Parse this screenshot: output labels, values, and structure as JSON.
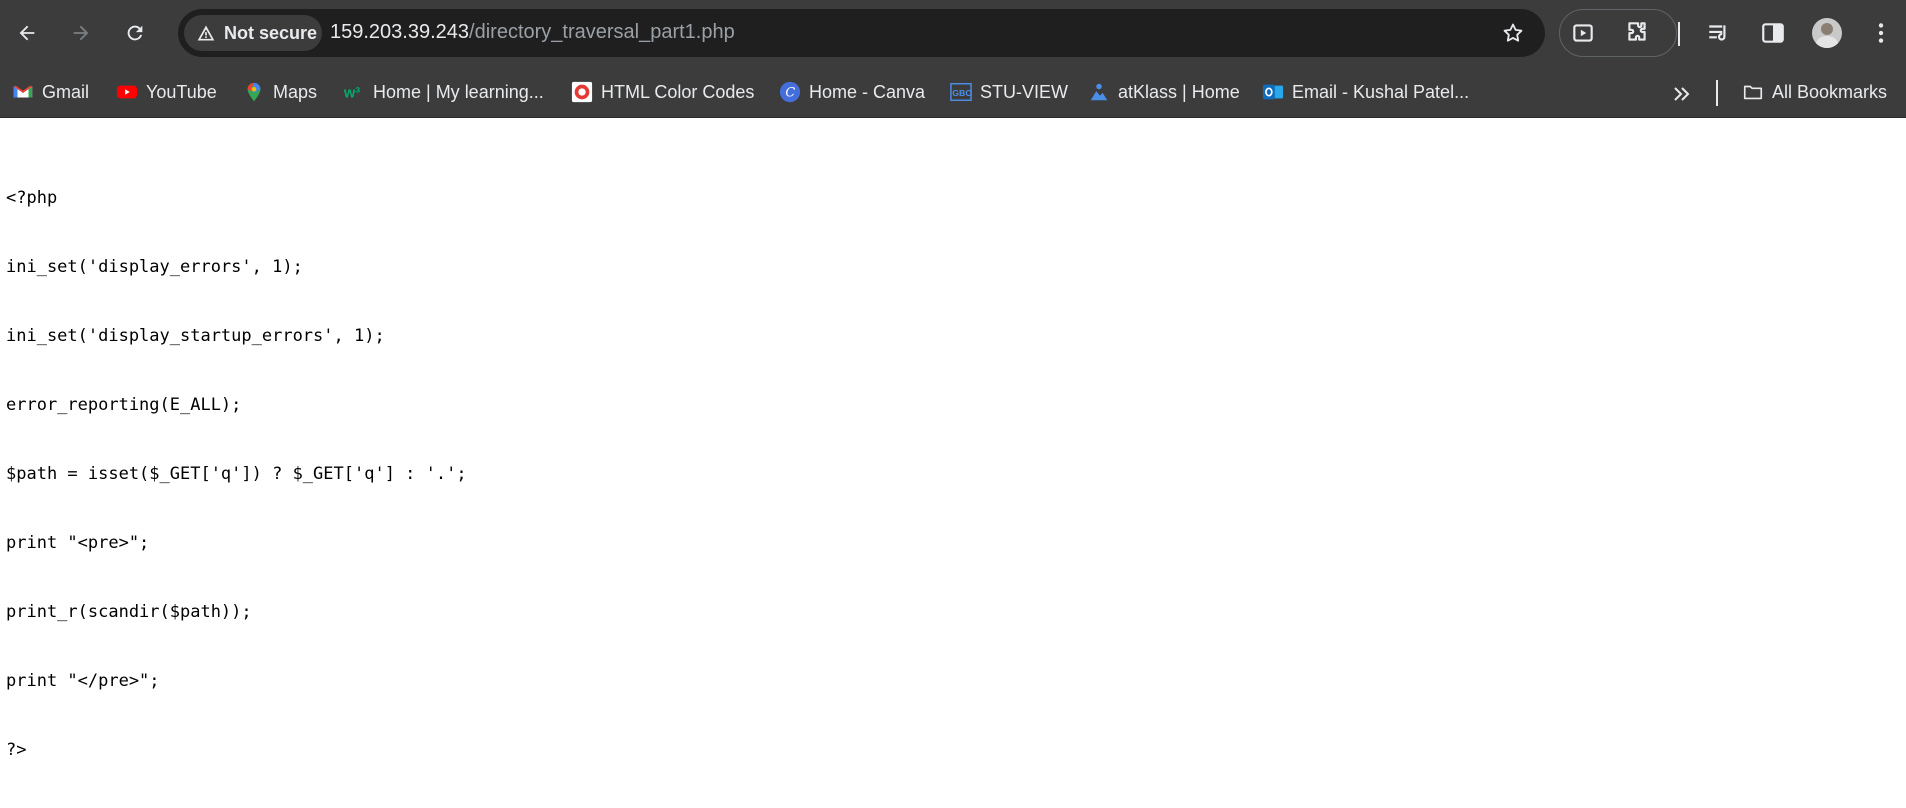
{
  "browser": {
    "security_label": "Not secure",
    "url_host": "159.203.39.243",
    "url_path": "/directory_traversal_part1.php"
  },
  "bookmarks": [
    {
      "label": "Gmail",
      "icon": "gmail-icon"
    },
    {
      "label": "YouTube",
      "icon": "youtube-icon"
    },
    {
      "label": "Maps",
      "icon": "maps-icon"
    },
    {
      "label": "Home | My learning...",
      "icon": "w3schools-icon"
    },
    {
      "label": "HTML Color Codes",
      "icon": "html-color-codes-icon"
    },
    {
      "label": "Home - Canva",
      "icon": "canva-icon"
    },
    {
      "label": "STU-VIEW",
      "icon": "gbc-icon"
    },
    {
      "label": "atKlass | Home",
      "icon": "atklass-icon"
    },
    {
      "label": "Email - Kushal Patel...",
      "icon": "outlook-icon"
    }
  ],
  "all_bookmarks_label": "All Bookmarks",
  "page": {
    "code_lines": [
      "<?php",
      "ini_set('display_errors', 1);",
      "ini_set('display_startup_errors', 1);",
      "error_reporting(E_ALL);",
      "$path = isset($_GET['q']) ? $_GET['q'] : '.';",
      "print \"<pre>\";",
      "print_r(scandir($path));",
      "print \"</pre>\";",
      "?>"
    ]
  }
}
